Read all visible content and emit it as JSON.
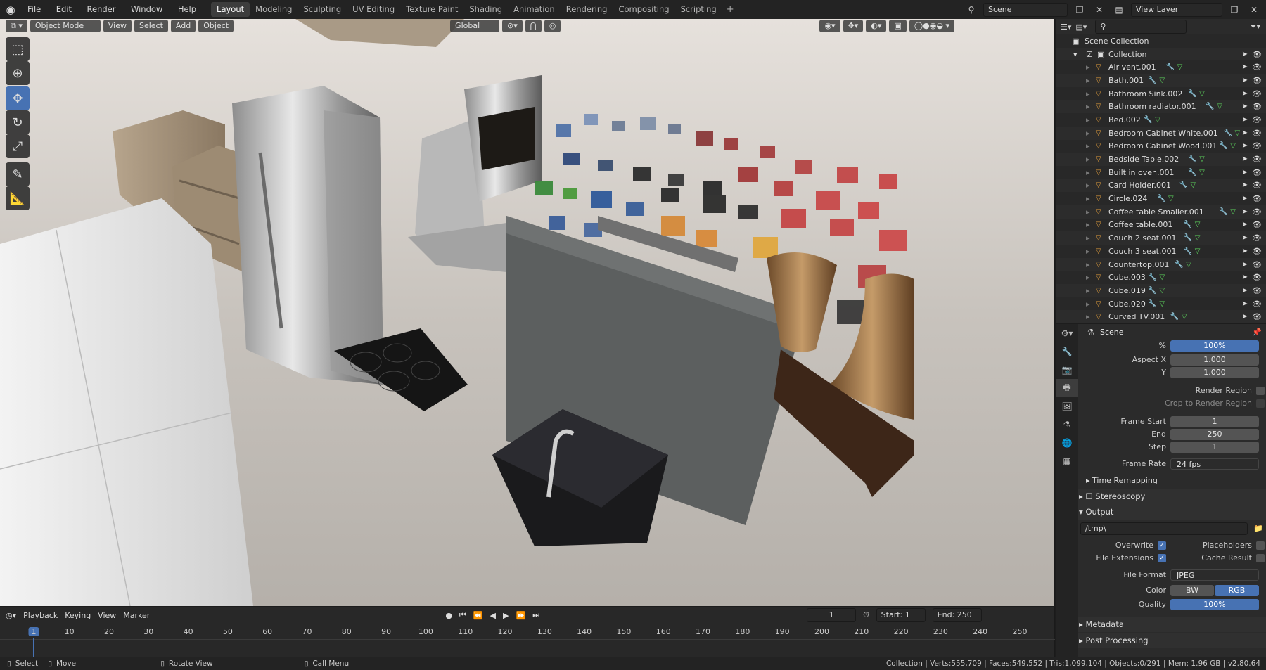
{
  "menu": [
    "File",
    "Edit",
    "Render",
    "Window",
    "Help"
  ],
  "workspaces": [
    "Layout",
    "Modeling",
    "Sculpting",
    "UV Editing",
    "Texture Paint",
    "Shading",
    "Animation",
    "Rendering",
    "Compositing",
    "Scripting"
  ],
  "scene_name": "Scene",
  "view_layer": "View Layer",
  "viewport": {
    "mode": "Object Mode",
    "menus": [
      "View",
      "Select",
      "Add",
      "Object"
    ],
    "orientation": "Global"
  },
  "outliner": {
    "root": "Scene Collection",
    "collection": "Collection",
    "items": [
      "Air vent.001",
      "Bath.001",
      "Bathroom Sink.002",
      "Bathroom radiator.001",
      "Bed.002",
      "Bedroom Cabinet White.001",
      "Bedroom Cabinet Wood.001",
      "Bedside Table.002",
      "Built in oven.001",
      "Card Holder.001",
      "Circle.024",
      "Coffee table Smaller.001",
      "Coffee table.001",
      "Couch 2 seat.001",
      "Couch 3 seat.001",
      "Countertop.001",
      "Cube.003",
      "Cube.019",
      "Cube.020",
      "Curved TV.001"
    ]
  },
  "properties": {
    "context": "Scene",
    "resolution_pct_label": "%",
    "resolution_pct": "100%",
    "aspect_x_label": "Aspect X",
    "aspect_x": "1.000",
    "aspect_y_label": "Y",
    "aspect_y": "1.000",
    "render_region": "Render Region",
    "crop_region": "Crop to Render Region",
    "frame_start_label": "Frame Start",
    "frame_start": "1",
    "end_label": "End",
    "end": "250",
    "step_label": "Step",
    "step": "1",
    "frame_rate_label": "Frame Rate",
    "frame_rate": "24 fps",
    "time_remapping": "Time Remapping",
    "stereoscopy": "Stereoscopy",
    "output": "Output",
    "output_path": "/tmp\\",
    "overwrite": "Overwrite",
    "placeholders": "Placeholders",
    "file_extensions": "File Extensions",
    "cache_result": "Cache Result",
    "file_format_label": "File Format",
    "file_format": "JPEG",
    "color_label": "Color",
    "color_bw": "BW",
    "color_rgb": "RGB",
    "quality_label": "Quality",
    "quality": "100%",
    "metadata": "Metadata",
    "post_processing": "Post Processing"
  },
  "timeline": {
    "menus": [
      "Playback",
      "Keying",
      "View",
      "Marker"
    ],
    "current_frame": "1",
    "start_label": "Start:",
    "start": "1",
    "end_label": "End:",
    "end": "250",
    "ticks": [
      "10",
      "20",
      "30",
      "40",
      "50",
      "60",
      "70",
      "80",
      "90",
      "100",
      "110",
      "120",
      "130",
      "140",
      "150",
      "160",
      "170",
      "180",
      "190",
      "200",
      "210",
      "220",
      "230",
      "240",
      "250"
    ]
  },
  "status": {
    "select": "Select",
    "move": "Move",
    "rotate": "Rotate View",
    "call_menu": "Call Menu",
    "stats": "Collection | Verts:555,709 | Faces:549,552 | Tris:1,099,104 | Objects:0/291 | Mem: 1.96 GB | v2.80.64"
  },
  "colors": {
    "accent": "#4772b3",
    "header": "#232323",
    "panel": "#2b2b2b"
  }
}
